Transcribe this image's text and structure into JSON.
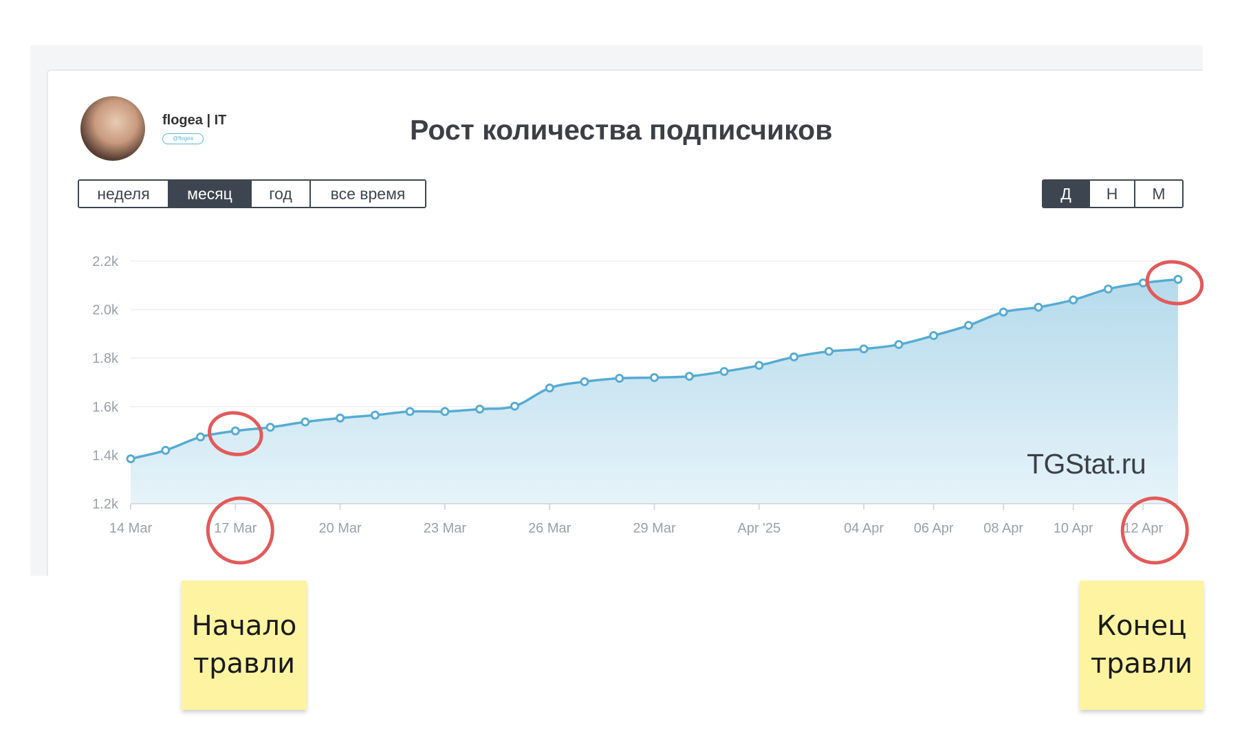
{
  "channel": {
    "name": "flogea | IT",
    "handle": "@flogea"
  },
  "title": "Рост количества подписчиков",
  "period_buttons": [
    {
      "label": "неделя",
      "active": false
    },
    {
      "label": "месяц",
      "active": true
    },
    {
      "label": "год",
      "active": false
    },
    {
      "label": "все время",
      "active": false
    }
  ],
  "granularity_buttons": [
    {
      "label": "Д",
      "active": true
    },
    {
      "label": "Н",
      "active": false
    },
    {
      "label": "М",
      "active": false
    }
  ],
  "watermark": "TGStat.ru",
  "notes": {
    "start": "Начало травли",
    "end": "Конец травли"
  },
  "colors": {
    "line": "#56abd2",
    "annotation": "#e35a5a",
    "sticky": "#fdf3a1"
  },
  "chart_data": {
    "type": "area",
    "title": "Рост количества подписчиков",
    "x": [
      "2025-03-14",
      "2025-03-15",
      "2025-03-16",
      "2025-03-17",
      "2025-03-18",
      "2025-03-19",
      "2025-03-20",
      "2025-03-21",
      "2025-03-22",
      "2025-03-23",
      "2025-03-24",
      "2025-03-25",
      "2025-03-26",
      "2025-03-27",
      "2025-03-28",
      "2025-03-29",
      "2025-03-30",
      "2025-03-31",
      "2025-04-01",
      "2025-04-02",
      "2025-04-03",
      "2025-04-04",
      "2025-04-05",
      "2025-04-06",
      "2025-04-07",
      "2025-04-08",
      "2025-04-09",
      "2025-04-10",
      "2025-04-11",
      "2025-04-12",
      "2025-04-13"
    ],
    "series": [
      {
        "values": [
          1385,
          1420,
          1475,
          1500,
          1515,
          1537,
          1553,
          1565,
          1580,
          1580,
          1590,
          1602,
          1677,
          1703,
          1717,
          1720,
          1725,
          1745,
          1770,
          1805,
          1828,
          1838,
          1856,
          1893,
          1935,
          1990,
          2010,
          2040,
          2085,
          2110,
          2125
        ]
      }
    ],
    "x_tick_labels": [
      {
        "x": "2025-03-14",
        "label": "14 Mar"
      },
      {
        "x": "2025-03-17",
        "label": "17 Mar"
      },
      {
        "x": "2025-03-20",
        "label": "20 Mar"
      },
      {
        "x": "2025-03-23",
        "label": "23 Mar"
      },
      {
        "x": "2025-03-26",
        "label": "26 Mar"
      },
      {
        "x": "2025-03-29",
        "label": "29 Mar"
      },
      {
        "x": "2025-04-01",
        "label": "Apr '25"
      },
      {
        "x": "2025-04-04",
        "label": "04 Apr"
      },
      {
        "x": "2025-04-06",
        "label": "06 Apr"
      },
      {
        "x": "2025-04-08",
        "label": "08 Apr"
      },
      {
        "x": "2025-04-10",
        "label": "10 Apr"
      },
      {
        "x": "2025-04-12",
        "label": "12 Apr"
      }
    ],
    "y_ticks": [
      1200,
      1400,
      1600,
      1800,
      2000,
      2200
    ],
    "y_tick_labels": [
      "1.2k",
      "1.4k",
      "1.6k",
      "1.8k",
      "2.0k",
      "2.2k"
    ],
    "ylim": [
      1200,
      2200
    ],
    "grid": true,
    "annotations": [
      {
        "type": "circle",
        "target": "point",
        "x": "2025-03-17"
      },
      {
        "type": "circle",
        "target": "x-tick",
        "x": "2025-03-17"
      },
      {
        "type": "circle",
        "target": "point",
        "x": "2025-04-13"
      },
      {
        "type": "circle",
        "target": "x-tick",
        "x": "2025-04-12"
      }
    ]
  }
}
